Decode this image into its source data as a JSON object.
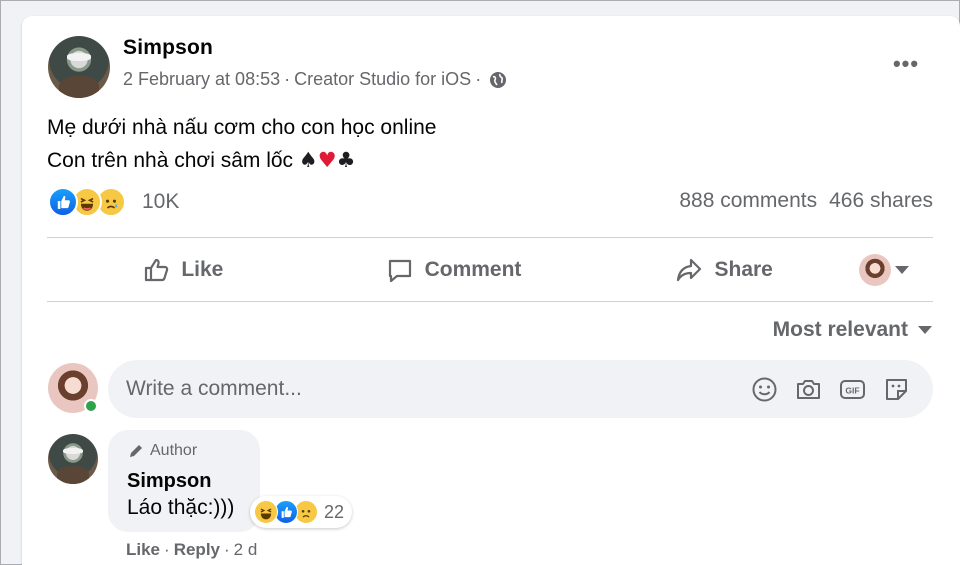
{
  "post": {
    "author": "Simpson",
    "timestamp": "2 February at 08:53",
    "source": "Creator Studio for iOS",
    "separator": "·",
    "more_icon": "more-options-icon",
    "privacy_icon": "globe-icon",
    "text_line1": "Mẹ dưới nhà nấu cơm cho con học online",
    "text_line2": "Con trên nhà chơi sâm lốc",
    "suits": [
      "♠",
      "♥",
      "♣"
    ]
  },
  "reactions": {
    "types": [
      "like",
      "haha",
      "sad"
    ],
    "count": "10K",
    "comments": "888 comments",
    "shares": "466 shares"
  },
  "actions": {
    "like": "Like",
    "comment": "Comment",
    "share": "Share"
  },
  "comments_section": {
    "sort_label": "Most relevant",
    "composer_placeholder": "Write a comment...",
    "composer_icons": [
      "emoji-icon",
      "camera-icon",
      "gif-icon",
      "sticker-icon"
    ]
  },
  "comment": {
    "badge": "Author",
    "name": "Simpson",
    "text": "Láo thặc:)))",
    "reaction_types": [
      "haha",
      "like",
      "sad"
    ],
    "reaction_count": "22",
    "like_label": "Like",
    "reply_label": "Reply",
    "age": "2 d"
  },
  "colors": {
    "page_bg": "#f0f2f5",
    "secondary_text": "#65676b",
    "like_blue": "#1877f2",
    "heart_red": "#e01b36",
    "online_green": "#31a24c"
  }
}
